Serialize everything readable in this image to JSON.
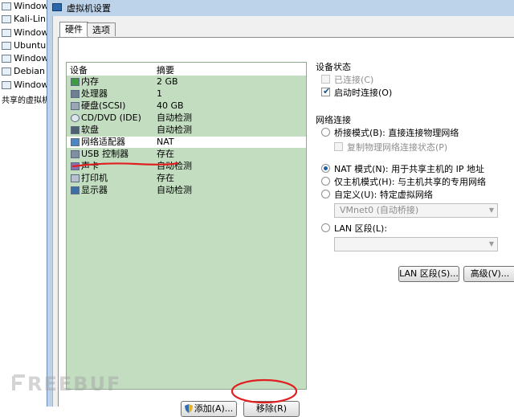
{
  "library": {
    "items": [
      "Window",
      "Kali-Linu",
      "Window",
      "Ubuntu",
      "Window",
      "Debian",
      "Window"
    ],
    "shared": "共享的虚拟机"
  },
  "dialog": {
    "title": "虚拟机设置"
  },
  "tabs": [
    {
      "label": "硬件"
    },
    {
      "label": "选项"
    }
  ],
  "device_list": {
    "headers": {
      "device": "设备",
      "summary": "摘要"
    },
    "rows": [
      {
        "name": "内存",
        "summary": "2 GB",
        "icon": "memory-icon"
      },
      {
        "name": "处理器",
        "summary": "1",
        "icon": "processor-icon"
      },
      {
        "name": "硬盘(SCSI)",
        "summary": "40 GB",
        "icon": "hard-disk-icon"
      },
      {
        "name": "CD/DVD (IDE)",
        "summary": "自动检测",
        "icon": "cd-dvd-icon"
      },
      {
        "name": "软盘",
        "summary": "自动检测",
        "icon": "floppy-icon"
      },
      {
        "name": "网络适配器",
        "summary": "NAT",
        "icon": "network-adapter-icon",
        "selected": true
      },
      {
        "name": "USB 控制器",
        "summary": "存在",
        "icon": "usb-icon"
      },
      {
        "name": "声卡",
        "summary": "自动检测",
        "icon": "sound-card-icon"
      },
      {
        "name": "打印机",
        "summary": "存在",
        "icon": "printer-icon"
      },
      {
        "name": "显示器",
        "summary": "自动检测",
        "icon": "display-icon"
      }
    ]
  },
  "device_status": {
    "title": "设备状态",
    "connected": "已连接(C)",
    "connect_at_power_on": "启动时连接(O)"
  },
  "network": {
    "title": "网络连接",
    "bridged": "桥接模式(B): 直接连接物理网络",
    "replicate": "复制物理网络连接状态(P)",
    "nat": "NAT 模式(N): 用于共享主机的 IP 地址",
    "host_only": "仅主机模式(H): 与主机共享的专用网络",
    "custom": "自定义(U): 特定虚拟网络",
    "custom_value": "VMnet0 (自动桥接)",
    "lan_segment": "LAN 区段(L):",
    "lan_segment_value": ""
  },
  "buttons": {
    "lan_segments": "LAN 区段(S)...",
    "advanced": "高级(V)...",
    "add": "添加(A)...",
    "remove": "移除(R)"
  },
  "watermark": "REEBUF",
  "colors": {
    "list_bg": "#c3ddc1",
    "annotation": "#e02020",
    "radio_dot": "#1e5ea8"
  }
}
